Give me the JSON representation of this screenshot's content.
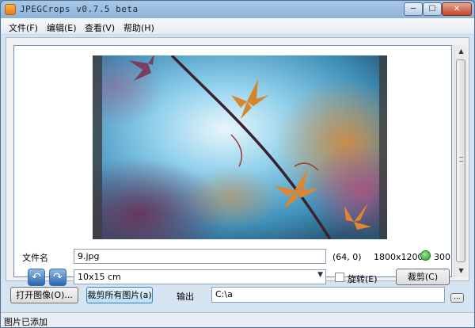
{
  "window": {
    "title": "JPEGCrops v0.7.5 beta",
    "controls": {
      "minimize": "─",
      "maximize": "☐",
      "close": "✕"
    }
  },
  "menu": [
    {
      "label": "文件(F)"
    },
    {
      "label": "编辑(E)"
    },
    {
      "label": "查看(V)"
    },
    {
      "label": "帮助(H)"
    }
  ],
  "editor": {
    "filename_label": "文件名",
    "filename_value": "9.jpg",
    "crop_position": "(64, 0)",
    "image_size": "1800x1200",
    "dpi": "300",
    "status_color": "#2ca52c",
    "rotate_left_icon": "rotate-left-icon",
    "rotate_right_icon": "rotate-right-icon",
    "rotate_left_glyph": "↶",
    "rotate_right_glyph": "↷",
    "format_selected": "10x15 cm",
    "rotate_checkbox_label": "旋转(E)",
    "rotate_checked": false,
    "crop_button": "裁剪(C)"
  },
  "bottom": {
    "open_button": "打开图像(O)...",
    "crop_all_button": "裁剪所有图片(a)",
    "output_label": "输出",
    "output_path": "C:\\a",
    "browse_button": "..."
  },
  "status": {
    "text": "图片已添加"
  },
  "photo": {
    "description_icon": "photo-preview",
    "accent_colors": [
      "#5fb3d8",
      "#c4682a",
      "#8a4a6a"
    ]
  }
}
